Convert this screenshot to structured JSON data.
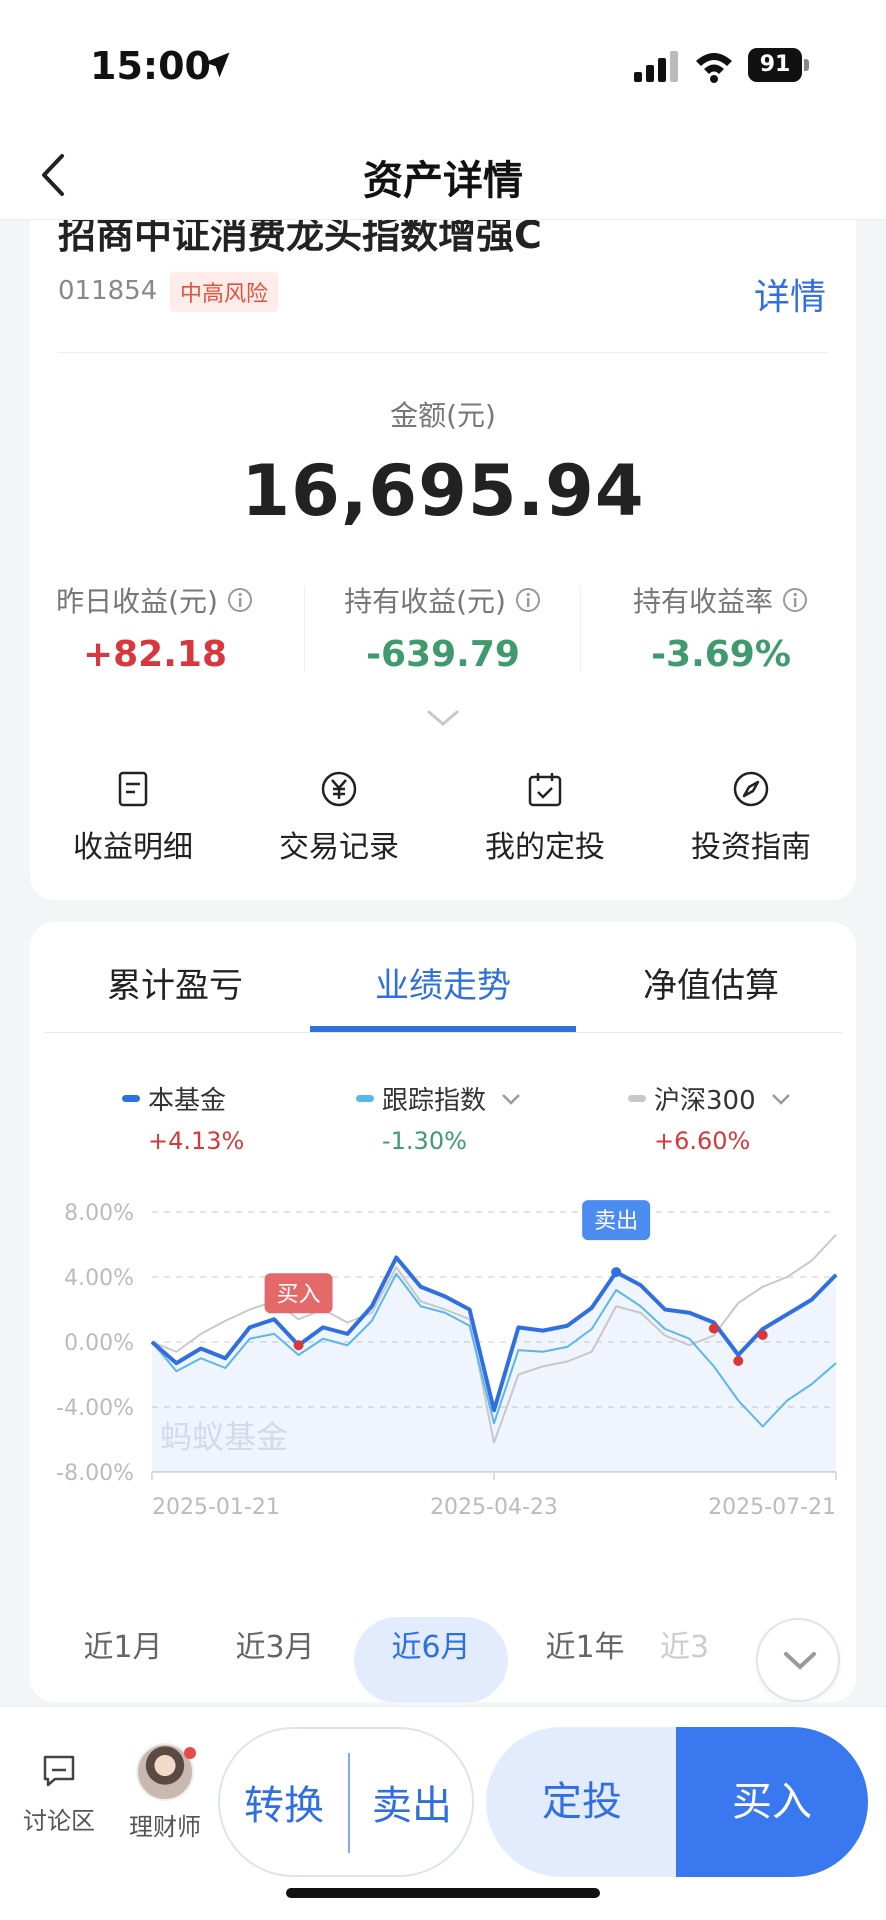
{
  "status_bar": {
    "time": "15:00",
    "battery": "91"
  },
  "nav": {
    "title": "资产详情"
  },
  "fund": {
    "name": "招商中证消费龙头指数增强C",
    "code": "011854",
    "risk": "中高风险",
    "detail_link": "详情",
    "amount_label": "金额(元)",
    "amount_value": "16,695.94"
  },
  "stats": [
    {
      "label": "昨日收益(元)",
      "value": "+82.18"
    },
    {
      "label": "持有收益(元)",
      "value": "-639.79"
    },
    {
      "label": "持有收益率",
      "value": "-3.69%"
    }
  ],
  "quick_actions": [
    {
      "label": "收益明细",
      "icon": "doc-icon"
    },
    {
      "label": "交易记录",
      "icon": "yen-icon"
    },
    {
      "label": "我的定投",
      "icon": "calendar-icon"
    },
    {
      "label": "投资指南",
      "icon": "compass-icon"
    }
  ],
  "tabs": [
    {
      "label": "累计盈亏"
    },
    {
      "label": "业绩走势",
      "active": true
    },
    {
      "label": "净值估算"
    }
  ],
  "legend": [
    {
      "name": "本基金",
      "value": "+4.13%",
      "color": "#2f6fe0"
    },
    {
      "name": "跟踪指数",
      "value": "-1.30%",
      "color": "#5ab7ea"
    },
    {
      "name": "沪深300",
      "value": "+6.60%",
      "color": "#c8c8c8"
    }
  ],
  "chart": {
    "watermark": "蚂蚁基金",
    "buy_label": "买入",
    "sell_label": "卖出"
  },
  "chart_data": {
    "type": "line",
    "y_ticks": [
      "8.00%",
      "4.00%",
      "0.00%",
      "-4.00%",
      "-8.00%"
    ],
    "x_ticks": [
      "2025-01-21",
      "2025-04-23",
      "2025-07-21"
    ],
    "ylim": [
      -8,
      8
    ],
    "series": [
      {
        "name": "本基金",
        "values": [
          0.0,
          -1.3,
          -0.4,
          -1.0,
          0.9,
          1.4,
          -0.2,
          0.9,
          0.5,
          2.2,
          5.2,
          3.4,
          2.8,
          2.0,
          -4.2,
          0.9,
          0.7,
          1.0,
          2.1,
          4.3,
          3.5,
          2.0,
          1.8,
          1.2,
          -0.8,
          0.8,
          1.7,
          2.6,
          4.13
        ]
      },
      {
        "name": "跟踪指数",
        "values": [
          0.0,
          -1.8,
          -1.0,
          -1.6,
          0.2,
          0.5,
          -0.8,
          0.2,
          -0.2,
          1.3,
          4.2,
          2.2,
          1.8,
          1.0,
          -5.0,
          -0.5,
          -0.6,
          -0.3,
          0.8,
          3.2,
          2.2,
          0.8,
          0.2,
          -1.5,
          -3.6,
          -5.2,
          -3.6,
          -2.6,
          -1.3
        ]
      },
      {
        "name": "沪深300",
        "values": [
          0.0,
          -0.6,
          0.5,
          1.3,
          2.0,
          2.5,
          1.4,
          2.0,
          1.2,
          1.8,
          4.6,
          2.5,
          2.0,
          1.4,
          -6.2,
          -2.0,
          -1.5,
          -1.2,
          -0.6,
          2.2,
          1.8,
          0.4,
          -0.2,
          0.4,
          2.4,
          3.4,
          4.0,
          5.0,
          6.6
        ]
      }
    ]
  },
  "periods": [
    {
      "label": "近1月"
    },
    {
      "label": "近3月"
    },
    {
      "label": "近6月",
      "active": true
    },
    {
      "label": "近1年"
    },
    {
      "label": "近3"
    }
  ],
  "bottom_bar": {
    "discuss": "讨论区",
    "advisor": "理财师",
    "convert": "转换",
    "sell": "卖出",
    "plan": "定投",
    "buy": "买入"
  }
}
